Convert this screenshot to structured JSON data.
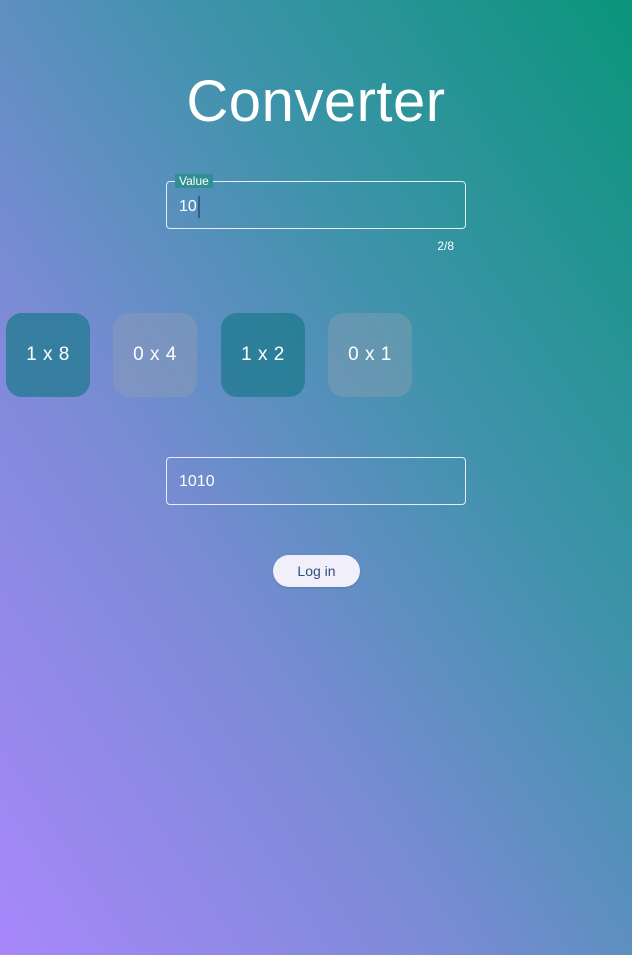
{
  "page": {
    "title": "Converter"
  },
  "input_field": {
    "label": "Value",
    "value": "10",
    "counter": "2/8"
  },
  "bits": [
    {
      "label": "1 x 8",
      "state": "on"
    },
    {
      "label": "0 x 4",
      "state": "off"
    },
    {
      "label": "1 x 2",
      "state": "on"
    },
    {
      "label": "0 x 1",
      "state": "off"
    }
  ],
  "result_field": {
    "value": "1010"
  },
  "login_button": {
    "label": "Log in"
  },
  "colors": {
    "gradient_bottom_left": "#a887fb",
    "gradient_top_right": "#0a957b",
    "bit_on": "#2a8296",
    "bit_off": "#8a9bb0",
    "button_bg": "#f1effa",
    "button_text": "#2e4f7e",
    "caret": "#2e5e8e"
  }
}
